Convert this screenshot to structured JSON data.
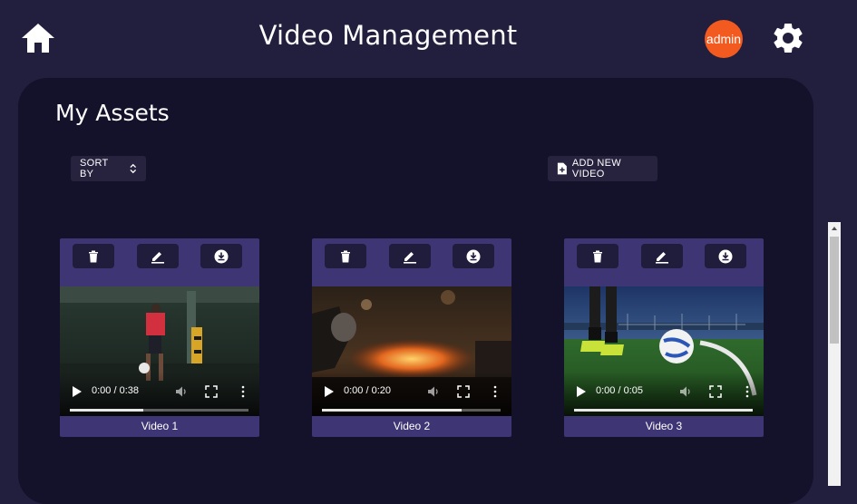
{
  "header": {
    "title": "Video Management",
    "avatar_label": "admin",
    "home_icon": "home-icon",
    "settings_icon": "gear-icon",
    "avatar_color": "#f25a1f"
  },
  "panel": {
    "title": "My Assets",
    "sort_label": "SORT BY",
    "add_label": "ADD NEW VIDEO"
  },
  "videos": [
    {
      "name": "Video 1",
      "time": "0:00 / 0:38",
      "buffered": 0.41
    },
    {
      "name": "Video 2",
      "time": "0:00 / 0:20",
      "buffered": 0.78
    },
    {
      "name": "Video 3",
      "time": "0:00 / 0:05",
      "buffered": 1.0
    }
  ],
  "colors": {
    "background": "#221e3e",
    "panel": "#14112b",
    "card": "#3e3575",
    "action_button": "#201c3b"
  }
}
